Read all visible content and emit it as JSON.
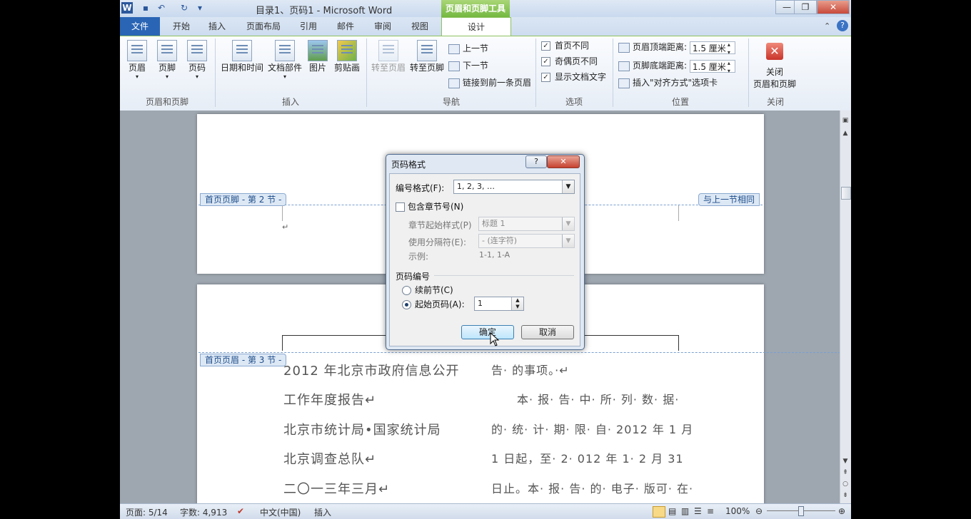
{
  "window": {
    "title": "目录1、页码1 - Microsoft Word",
    "contextual_title": "页眉和页脚工具",
    "quick_access": [
      "word-icon",
      "save-icon",
      "undo-icon",
      "redo-icon",
      "customize-icon"
    ]
  },
  "tabs": [
    "文件",
    "开始",
    "插入",
    "页面布局",
    "引用",
    "邮件",
    "审阅",
    "视图",
    "设计"
  ],
  "ribbon": {
    "groups": {
      "header_footer": {
        "label": "页眉和页脚",
        "buttons": [
          "页眉",
          "页脚",
          "页码"
        ]
      },
      "insert": {
        "label": "插入",
        "buttons": [
          "日期和时间",
          "文档部件",
          "图片",
          "剪贴画"
        ]
      },
      "nav": {
        "label": "导航",
        "buttons": [
          "转至页眉",
          "转至页脚"
        ],
        "small": [
          "上一节",
          "下一节",
          "链接到前一条页眉"
        ]
      },
      "options": {
        "label": "选项",
        "items": [
          "首页不同",
          "奇偶页不同",
          "显示文档文字"
        ]
      },
      "position": {
        "label": "位置",
        "header_label": "页眉顶端距离:",
        "header_value": "1.5 厘米",
        "footer_label": "页脚底端距离:",
        "footer_value": "1.5 厘米",
        "align_tab": "插入\"对齐方式\"选项卡"
      },
      "close": {
        "label": "关闭",
        "button_line1": "关闭",
        "button_line2": "页眉和页脚"
      }
    }
  },
  "document": {
    "footer_tag_sec2": "首页页脚 - 第 2 节 -",
    "same_as_prev": "与上一节相同",
    "header_tag_sec3": "首页页眉 - 第 3 节 -",
    "left_col": [
      "2012 年北京市政府信息公开",
      "工作年度报告↵",
      "北京市统计局•国家统计局",
      "北京调查总队↵",
      "二〇一三年三月↵"
    ],
    "right_col": [
      "告· 的事项。·↵",
      "本· 报· 告· 中· 所· 列· 数· 据·",
      "的· 统· 计· 期· 限· 自· 2012 年 1 月",
      "1 日起，至· 2· 012 年 1· 2 月 31",
      "日止。本· 报· 告· 的· 电子· 版可· 在·"
    ]
  },
  "dialog": {
    "title": "页码格式",
    "number_format_label": "编号格式(F):",
    "number_format_value": "1, 2, 3, …",
    "include_chapter_label": "包含章节号(N)",
    "chapter_style_label": "章节起始样式(P)",
    "chapter_style_value": "标题 1",
    "separator_label": "使用分隔符(E):",
    "separator_value": "-   (连字符)",
    "example_label": "示例:",
    "example_value": "1-1, 1-A",
    "numbering_section": "页码编号",
    "continue_label": "续前节(C)",
    "start_at_label": "起始页码(A):",
    "start_at_value": "1",
    "ok": "确定",
    "cancel": "取消"
  },
  "status": {
    "page": "页面: 5/14",
    "words": "字数: 4,913",
    "language": "中文(中国)",
    "mode": "插入",
    "zoom": "100%"
  }
}
